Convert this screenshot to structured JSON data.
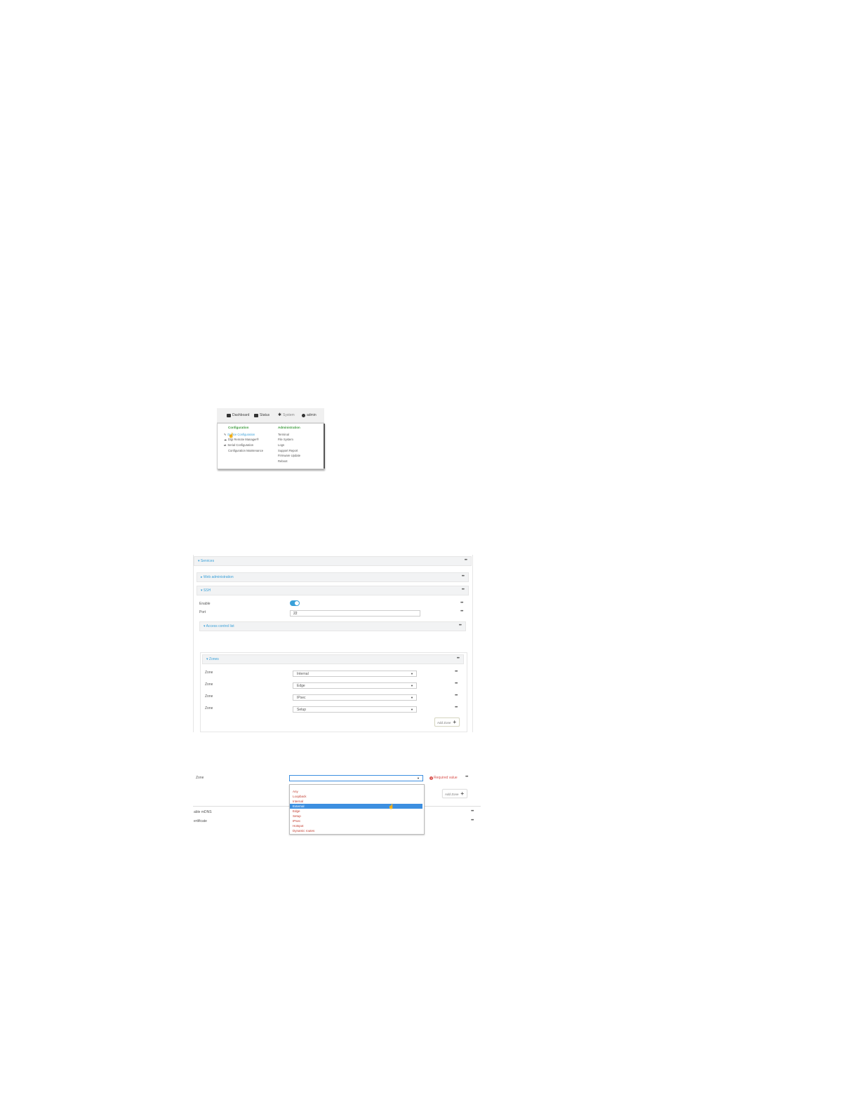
{
  "topnav": {
    "dashboard": "Dashboard",
    "status": "Status",
    "system": "System",
    "admin": "admin"
  },
  "menu": {
    "config_head": "Configuration",
    "admin_head": "Administration",
    "config_items": [
      "Device Configuration",
      "Digi Remote Manager®",
      "Serial Configuration",
      "Configuration Maintenance"
    ],
    "admin_items": [
      "Terminal",
      "File System",
      "Logs",
      "Support Report",
      "Firmware Update",
      "Reboot"
    ]
  },
  "services": {
    "title": "Services",
    "web_admin": "Web administration",
    "ssh": "SSH",
    "enable_label": "Enable",
    "port_label": "Port",
    "port_value": "22",
    "acl": "Access control list",
    "zones": "Zones",
    "zone_label": "Zone",
    "zone_values": [
      "Internal",
      "Edge",
      "IPsec",
      "Setup"
    ],
    "add_zone": "Add Zone"
  },
  "dropdown": {
    "zone_label": "Zone",
    "required": "Required value",
    "add_zone": "Add Zone",
    "behind_1": "able mDNS",
    "behind_2": "ertificate",
    "options": [
      "Any",
      "Loopback",
      "Internal",
      "External",
      "Edge",
      "Setup",
      "IPsec",
      "Hotspot",
      "Dynamic routes"
    ],
    "selected_index": 3
  }
}
